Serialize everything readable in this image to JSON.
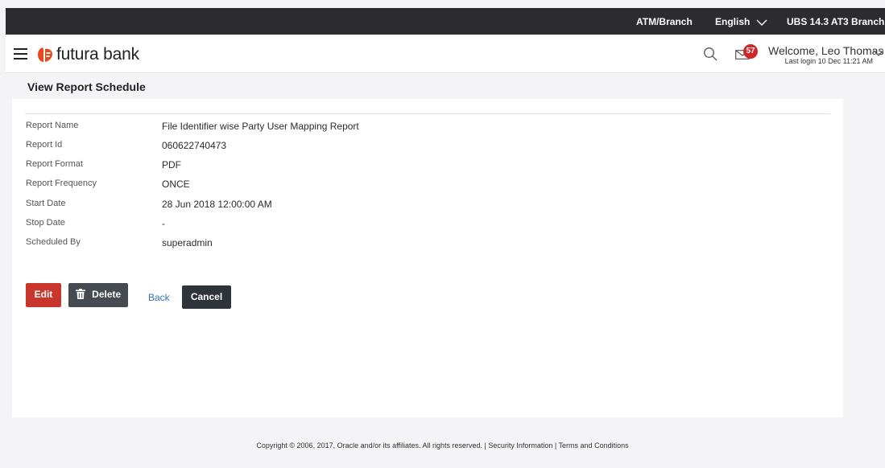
{
  "topbar": {
    "atm_branch": "ATM/Branch",
    "language": "English",
    "branch": "UBS 14.3 AT3 Branch"
  },
  "header": {
    "brand": "futura bank",
    "mail_count": "57",
    "welcome": "Welcome, Leo Thomas",
    "last_login": "Last login 10 Dec 11:21 AM"
  },
  "page": {
    "title": "View Report Schedule"
  },
  "details": [
    {
      "label": "Report Name",
      "value": "File Identifier wise Party User Mapping Report"
    },
    {
      "label": "Report Id",
      "value": "060622740473"
    },
    {
      "label": "Report Format",
      "value": "PDF"
    },
    {
      "label": "Report Frequency",
      "value": "ONCE"
    },
    {
      "label": "Start Date",
      "value": "28 Jun 2018 12:00:00 AM"
    },
    {
      "label": "Stop Date",
      "value": "-"
    },
    {
      "label": "Scheduled By",
      "value": "superadmin"
    }
  ],
  "actions": {
    "edit": "Edit",
    "delete": "Delete",
    "back": "Back",
    "cancel": "Cancel"
  },
  "footer": {
    "copyright": "Copyright © 2006, 2017, Oracle and/or its affiliates. All rights reserved. | Security Information | Terms and Conditions"
  },
  "colors": {
    "topbar": "#2b2b30",
    "brand": "#e8491d",
    "edit_button": "#c9372c",
    "delete_button": "#464b52",
    "cancel_button": "#2f333a",
    "badge": "#d0262a",
    "link": "#3b6fb6"
  }
}
